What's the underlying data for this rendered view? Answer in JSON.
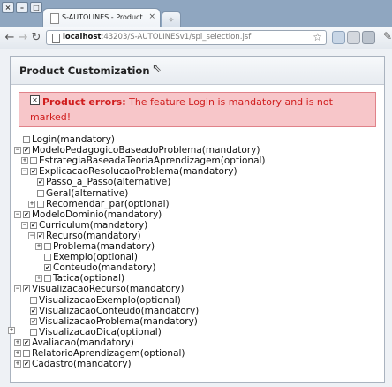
{
  "window": {
    "tab_title": "S-AUTOLINES - Product ...",
    "tab_close": "×"
  },
  "toolbar": {
    "url_host": "localhost",
    "url_path": ":43203/S-AUTOLINESv1/spl_selection.jsf"
  },
  "panel": {
    "title": "Product Customization"
  },
  "error": {
    "heading": "Product errors:",
    "message": " The feature Login is mandatory and is not marked!"
  },
  "tree": [
    {
      "label": "Login(mandatory)",
      "checked": false,
      "toggle": "",
      "indent": 0
    },
    {
      "label": "ModeloPedagogicoBaseadoProblema(mandatory)",
      "checked": true,
      "toggle": "−",
      "indent": 0
    },
    {
      "label": "EstrategiaBaseadaTeoriaAprendizagem(optional)",
      "checked": false,
      "toggle": "+",
      "indent": 1
    },
    {
      "label": "ExplicacaoResolucaoProblema(mandatory)",
      "checked": true,
      "toggle": "−",
      "indent": 1
    },
    {
      "label": "Passo_a_Passo(alternative)",
      "checked": true,
      "toggle": "",
      "indent": 2
    },
    {
      "label": "Geral(alternative)",
      "checked": false,
      "toggle": "",
      "indent": 2
    },
    {
      "label": "Recomendar_par(optional)",
      "checked": false,
      "toggle": "+",
      "indent": 2
    },
    {
      "label": "ModeloDominio(mandatory)",
      "checked": true,
      "toggle": "−",
      "indent": 0
    },
    {
      "label": "Curriculum(mandatory)",
      "checked": true,
      "toggle": "−",
      "indent": 1
    },
    {
      "label": "Recurso(mandatory)",
      "checked": true,
      "toggle": "−",
      "indent": 2
    },
    {
      "label": "Problema(mandatory)",
      "checked": false,
      "toggle": "+",
      "indent": 3
    },
    {
      "label": "Exemplo(optional)",
      "checked": false,
      "toggle": "",
      "indent": 3
    },
    {
      "label": "Conteudo(mandatory)",
      "checked": true,
      "toggle": "",
      "indent": 3
    },
    {
      "label": "Tatica(optional)",
      "checked": false,
      "toggle": "+",
      "indent": 3
    },
    {
      "label": "VisualizacaoRecurso(mandatory)",
      "checked": true,
      "toggle": "−",
      "indent": 0
    },
    {
      "label": "VisualizacaoExemplo(optional)",
      "checked": false,
      "toggle": "",
      "indent": 1
    },
    {
      "label": "VisualizacaoConteudo(mandatory)",
      "checked": true,
      "toggle": "",
      "indent": 1
    },
    {
      "label": "VisualizacaoProblema(mandatory)",
      "checked": true,
      "toggle": "",
      "indent": 1
    },
    {
      "label": "VisualizacaoDica(optional)",
      "checked": false,
      "toggle": "",
      "indent": 1
    },
    {
      "label": "Avaliacao(mandatory)",
      "checked": true,
      "toggle": "+",
      "indent": 0
    },
    {
      "label": "RelatorioAprendizagem(optional)",
      "checked": false,
      "toggle": "+",
      "indent": 0
    },
    {
      "label": "Cadastro(mandatory)",
      "checked": true,
      "toggle": "+",
      "indent": 0
    }
  ],
  "icons": {
    "checked_glyph": "✔",
    "error_glyph": "✕",
    "cursor_glyph": "⇖"
  }
}
